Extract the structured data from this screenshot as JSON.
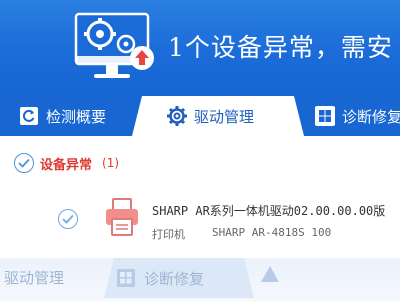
{
  "header": {
    "title": "1个设备异常，需安"
  },
  "tabs": [
    {
      "label": "检测概要",
      "icon": "refresh-doc-icon",
      "active": false
    },
    {
      "label": "驱动管理",
      "icon": "gear-icon",
      "active": true
    },
    {
      "label": "诊断修复",
      "icon": "windows-icon",
      "active": false
    }
  ],
  "section": {
    "title": "设备异常",
    "count": "(1)"
  },
  "device": {
    "name": "SHARP AR系列一体机驱动02.00.00.00版",
    "type": "打印机",
    "model": "SHARP AR-4818S  100"
  },
  "ghost": {
    "left_label": "驱动管理",
    "tab_label": "诊断修复"
  },
  "colors": {
    "banner": "#1a6ad8",
    "alert": "#e03a2f",
    "accent": "#1f5fbf"
  }
}
